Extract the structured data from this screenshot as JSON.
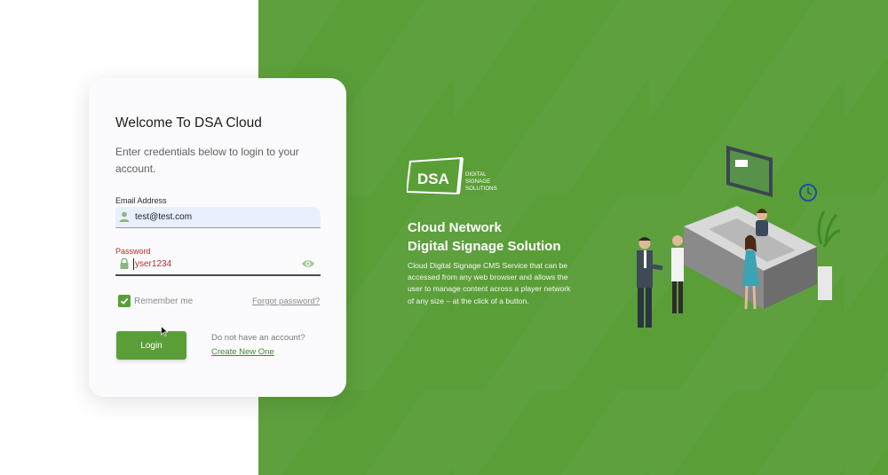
{
  "login": {
    "title": "Welcome To DSA Cloud",
    "subtitle": "Enter credentials below to login to your account.",
    "email_label": "Email Address",
    "email_value": "test@test.com",
    "password_label": "Password",
    "password_value": "yser1234",
    "remember_label": "Remember me",
    "remember_checked": true,
    "forgot_label": "Forgot password?",
    "login_label": "Login",
    "no_account_text": "Do not have an account?",
    "create_label": "Create New One"
  },
  "brand": {
    "logo_text": "DSA",
    "logo_sub_1": "DIGITAL",
    "logo_sub_2": "SIGNAGE",
    "logo_sub_3": "SOLUTIONS",
    "headline_1": "Cloud Network",
    "headline_2": "Digital Signage Solution",
    "description": "Cloud Digital Signage CMS Service that can be accessed from any web browser and allows the user to manage content across a player network of any size – at the click of a button."
  },
  "colors": {
    "accent": "#5a9e38",
    "error": "#c62828",
    "link": "#3d8a27"
  },
  "icons": {
    "email": "person-icon",
    "password": "lock-icon",
    "toggle": "eye-icon",
    "checkbox": "check-icon"
  }
}
